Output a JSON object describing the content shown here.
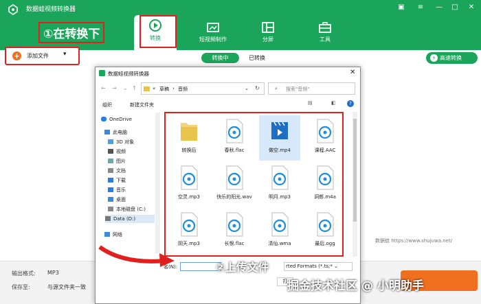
{
  "app": {
    "title": "数据蛙视频转换器"
  },
  "nav": {
    "tabs": [
      {
        "label": "转换"
      },
      {
        "label": "短视频制作"
      },
      {
        "label": "分屏"
      },
      {
        "label": "工具"
      }
    ]
  },
  "annotations": {
    "step1": "①在转换下",
    "step2": "②上传文件",
    "credit": "掘金技术社区 @ 小明助手"
  },
  "toolbar": {
    "add_file": "添加文件",
    "converting": "转换中",
    "converted": "已转换",
    "high_speed": "高速转换"
  },
  "bottom": {
    "format_label": "输出格式:",
    "format_value": "MP3",
    "save_label": "保存至:",
    "save_value": "与源文件夹一致",
    "watermark": "数据蛙  https://www.shujuwa.net/"
  },
  "dialog": {
    "title": "数据蛙视频转换器",
    "path": [
      "草稿",
      "音频"
    ],
    "search_placeholder": "搜索\"音频\"",
    "organize": "组织",
    "new_folder": "新建文件夹",
    "sidebar": [
      "OneDrive",
      "此电脑",
      "3D 对象",
      "视频",
      "图片",
      "文档",
      "下载",
      "音乐",
      "桌面",
      "本地磁盘 (C:)",
      "Data (D:)",
      "网络"
    ],
    "files": [
      "转换后",
      "春秋.flac",
      "做空.mp4",
      "课程.AAC",
      "空灵.mp3",
      "快乐的阳光.wav",
      "明月.mp3",
      "洞郎.m4a",
      "阴天.mp3",
      "长恨.flac",
      "清仙.wma",
      "最后.ogg"
    ],
    "filename_label": "名(N):",
    "filter_value": "rted Formats (*.ts;*",
    "open_button": "打"
  },
  "colors": {
    "brand": "#1aa55a",
    "accent": "#f07020",
    "annotation": "#e0201c"
  }
}
